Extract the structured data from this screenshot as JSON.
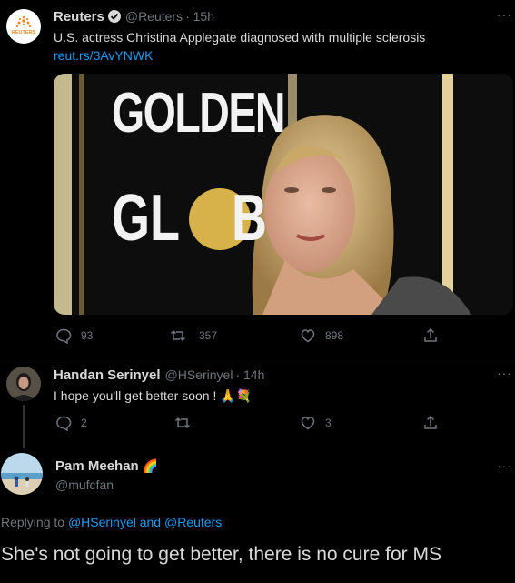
{
  "tweet1": {
    "name": "Reuters",
    "verified": true,
    "handle": "@Reuters",
    "time": "· 15h",
    "avatar_text": "REUTERS",
    "text": "U.S. actress Christina Applegate diagnosed with multiple sclerosis",
    "link": "reut.rs/3AvYNWK",
    "image_sign": {
      "line1": "GOLDEN",
      "line2": "GL",
      "line3": "B"
    },
    "replies": "93",
    "retweets": "357",
    "likes": "898"
  },
  "tweet2": {
    "name": "Handan Serinyel",
    "handle": "@HSerinyel",
    "time": "· 14h",
    "text": "I hope you'll get better soon ! 🙏💐",
    "replies": "2",
    "retweets": "",
    "likes": "3"
  },
  "tweet3": {
    "name": "Pam Meehan",
    "name_emoji": "🌈",
    "handle": "@mufcfan",
    "replying_prefix": "Replying to",
    "replying_user1": "@HSerinyel",
    "replying_and": "and",
    "replying_user2": "@Reuters",
    "text": "She's not going to get better, there is no cure for MS"
  },
  "icons": [
    "more-icon",
    "reply-icon",
    "retweet-icon",
    "like-icon",
    "share-icon",
    "verified-icon"
  ],
  "colors": {
    "background": "#000000",
    "link": "#1d9bf0",
    "muted": "#6e767d",
    "text": "#d9d9d9"
  }
}
